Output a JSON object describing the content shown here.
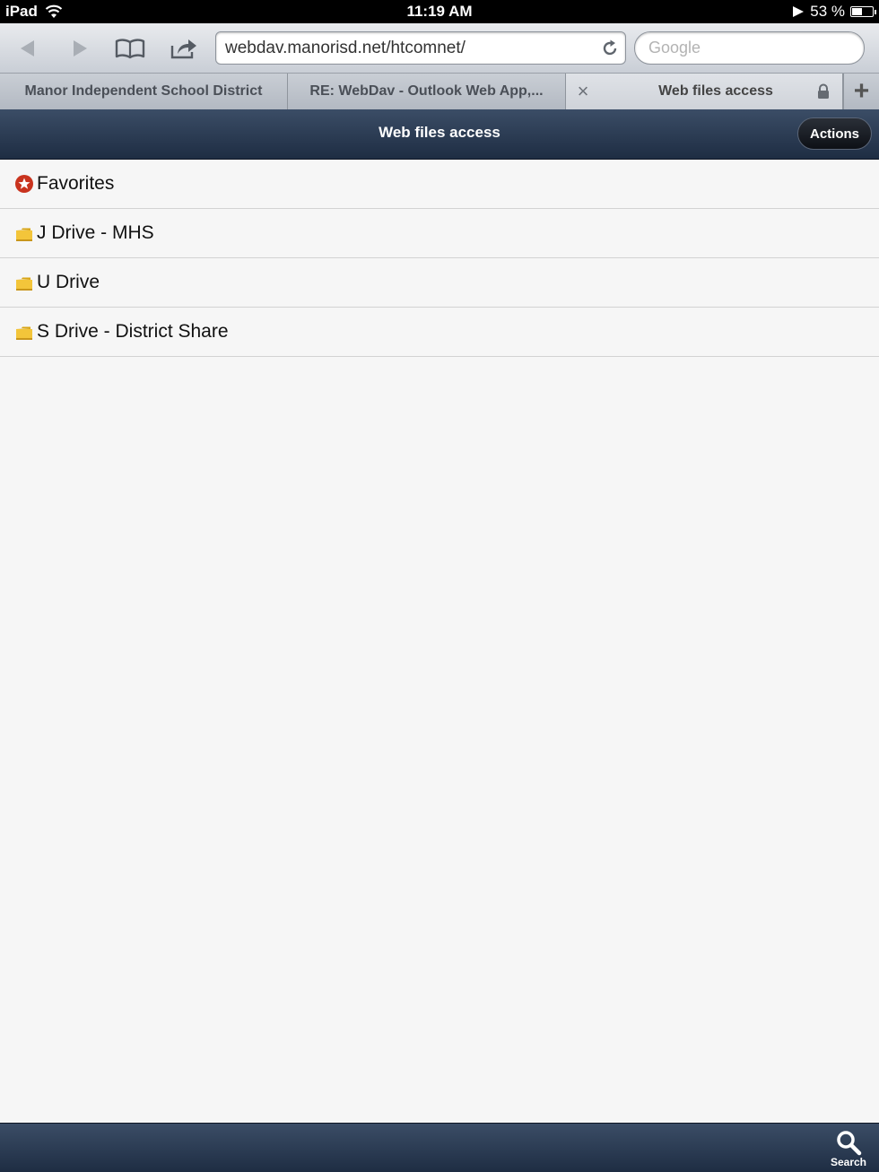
{
  "status_bar": {
    "device": "iPad",
    "time": "11:19 AM",
    "battery_text": "53 %",
    "battery_level": 0.53
  },
  "browser": {
    "url": "webdav.manorisd.net/htcomnet/",
    "search_placeholder": "Google",
    "tabs": [
      {
        "label": "Manor Independent School District"
      },
      {
        "label": "RE: WebDav - Outlook Web App,..."
      },
      {
        "label": "Web files access"
      }
    ],
    "add_tab_label": "+",
    "close_tab_label": "×"
  },
  "app": {
    "title": "Web files access",
    "actions_label": "Actions",
    "items": [
      {
        "label": "Favorites",
        "icon": "favorites-star-icon"
      },
      {
        "label": "J Drive - MHS",
        "icon": "folder-icon"
      },
      {
        "label": "U Drive",
        "icon": "folder-icon"
      },
      {
        "label": "S Drive - District Share",
        "icon": "folder-icon"
      }
    ],
    "search_label": "Search"
  }
}
